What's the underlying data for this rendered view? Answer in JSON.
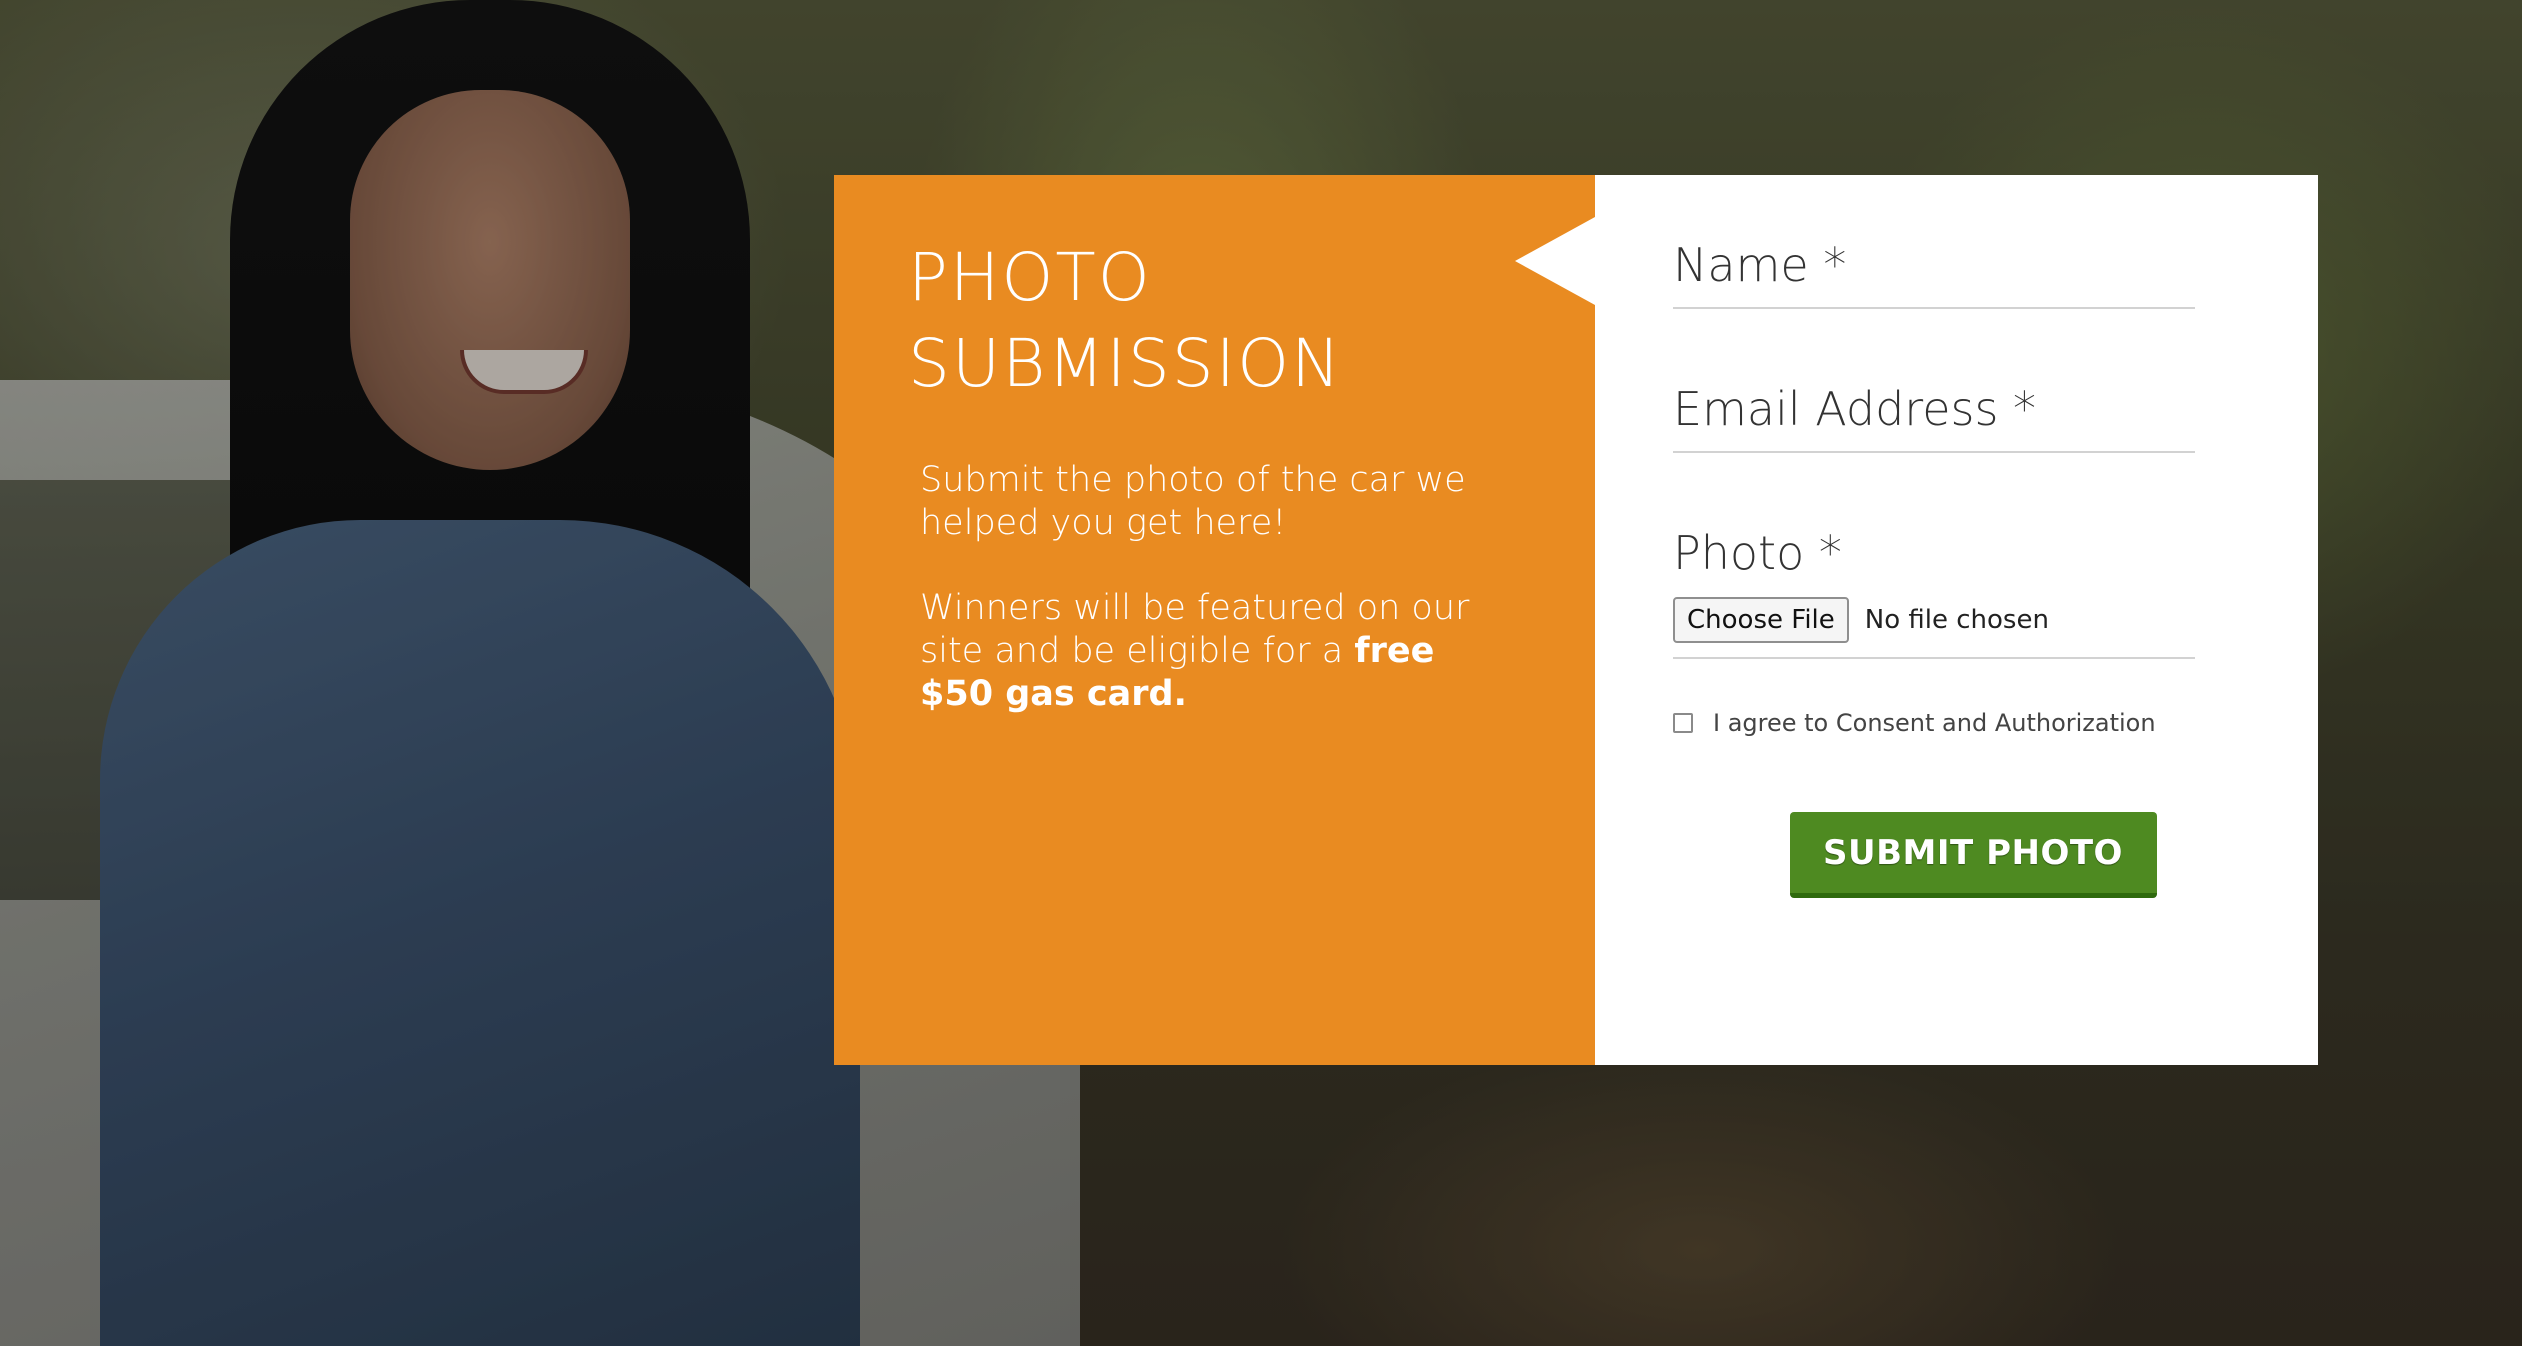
{
  "intro": {
    "title": "PHOTO SUBMISSION",
    "paragraph_1": "Submit the photo of the car we helped you get here!",
    "paragraph_2": "Winners will be featured on our site and be eligible for a",
    "paragraph_2_emphasis": "free $50 gas card."
  },
  "form": {
    "name_label": "Name *",
    "email_label": "Email Address *",
    "photo_label": "Photo *",
    "file_button_label": "Choose File",
    "file_status": "No file chosen",
    "consent_label": "I agree to Consent and Authorization",
    "submit_label": "SUBMIT PHOTO"
  },
  "colors": {
    "accent_orange": "#e98b21",
    "submit_green": "#4e8a21",
    "panel_white": "#ffffff"
  }
}
